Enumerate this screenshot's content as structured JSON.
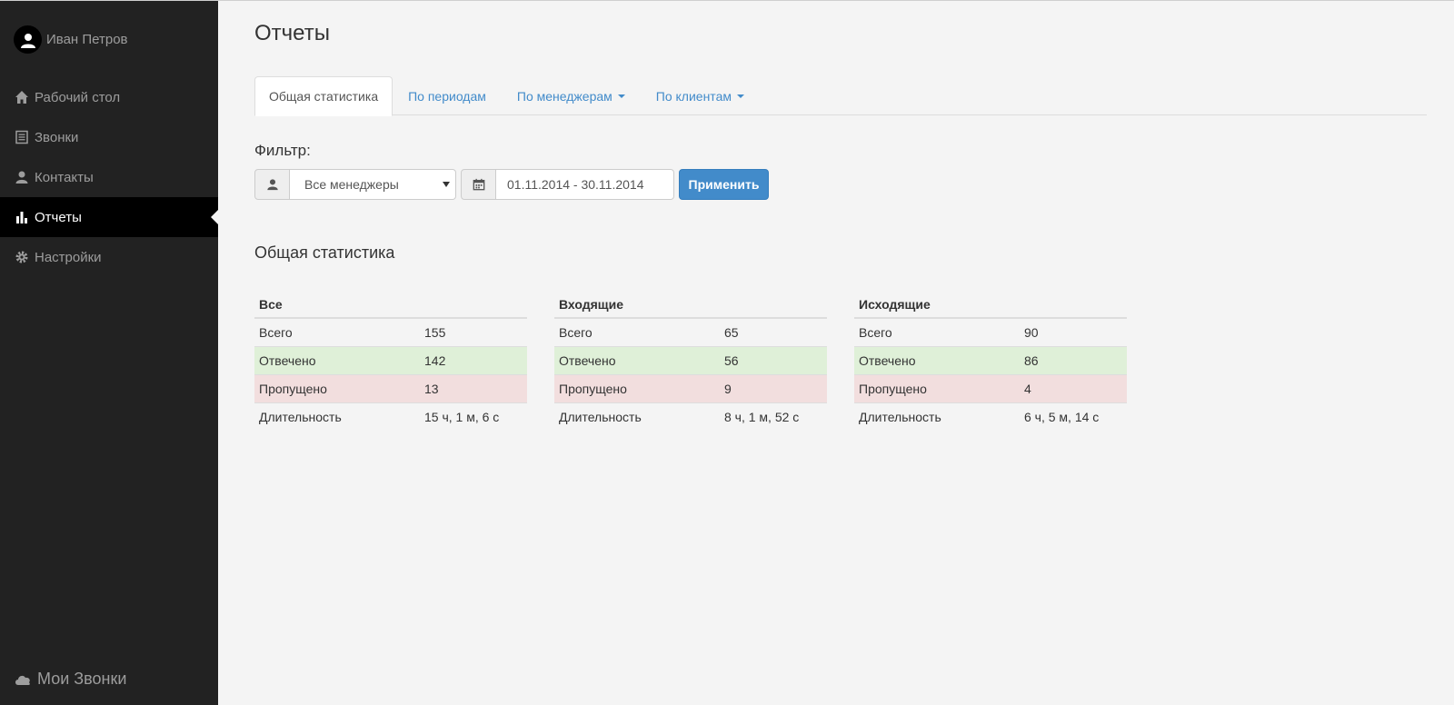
{
  "user": {
    "name": "Иван Петров"
  },
  "nav": [
    {
      "label": "Рабочий стол",
      "icon": "home-icon"
    },
    {
      "label": "Звонки",
      "icon": "list-icon"
    },
    {
      "label": "Контакты",
      "icon": "user-icon"
    },
    {
      "label": "Отчеты",
      "icon": "bar-chart-icon",
      "active": true
    },
    {
      "label": "Настройки",
      "icon": "gear-icon"
    }
  ],
  "brand": {
    "label": "Мои Звонки",
    "icon": "cloud-icon"
  },
  "page": {
    "title": "Отчеты"
  },
  "tabs": [
    {
      "label": "Общая статистика",
      "active": true
    },
    {
      "label": "По периодам"
    },
    {
      "label": "По менеджерам",
      "dropdown": true
    },
    {
      "label": "По клиентам",
      "dropdown": true
    }
  ],
  "filter": {
    "label": "Фильтр:",
    "manager_select": "Все менеджеры",
    "date_range": "01.11.2014 - 30.11.2014",
    "apply_label": "Применить"
  },
  "stats": {
    "title": "Общая статистика",
    "tables": [
      {
        "heading": "Все",
        "rows": [
          {
            "label": "Всего",
            "value": "155"
          },
          {
            "label": "Отвечено",
            "value": "142"
          },
          {
            "label": "Пропущено",
            "value": "13"
          },
          {
            "label": "Длительность",
            "value": "15 ч, 1 м, 6 с"
          }
        ]
      },
      {
        "heading": "Входящие",
        "rows": [
          {
            "label": "Всего",
            "value": "65"
          },
          {
            "label": "Отвечено",
            "value": "56"
          },
          {
            "label": "Пропущено",
            "value": "9"
          },
          {
            "label": "Длительность",
            "value": "8 ч, 1 м, 52 с"
          }
        ]
      },
      {
        "heading": "Исходящие",
        "rows": [
          {
            "label": "Всего",
            "value": "90"
          },
          {
            "label": "Отвечено",
            "value": "86"
          },
          {
            "label": "Пропущено",
            "value": "4"
          },
          {
            "label": "Длительность",
            "value": "6 ч, 5 м, 14 с"
          }
        ]
      }
    ]
  },
  "colors": {
    "sidebar_bg": "#222222",
    "accent": "#428bca",
    "success_row": "#dff0d8",
    "danger_row": "#f2dede"
  }
}
